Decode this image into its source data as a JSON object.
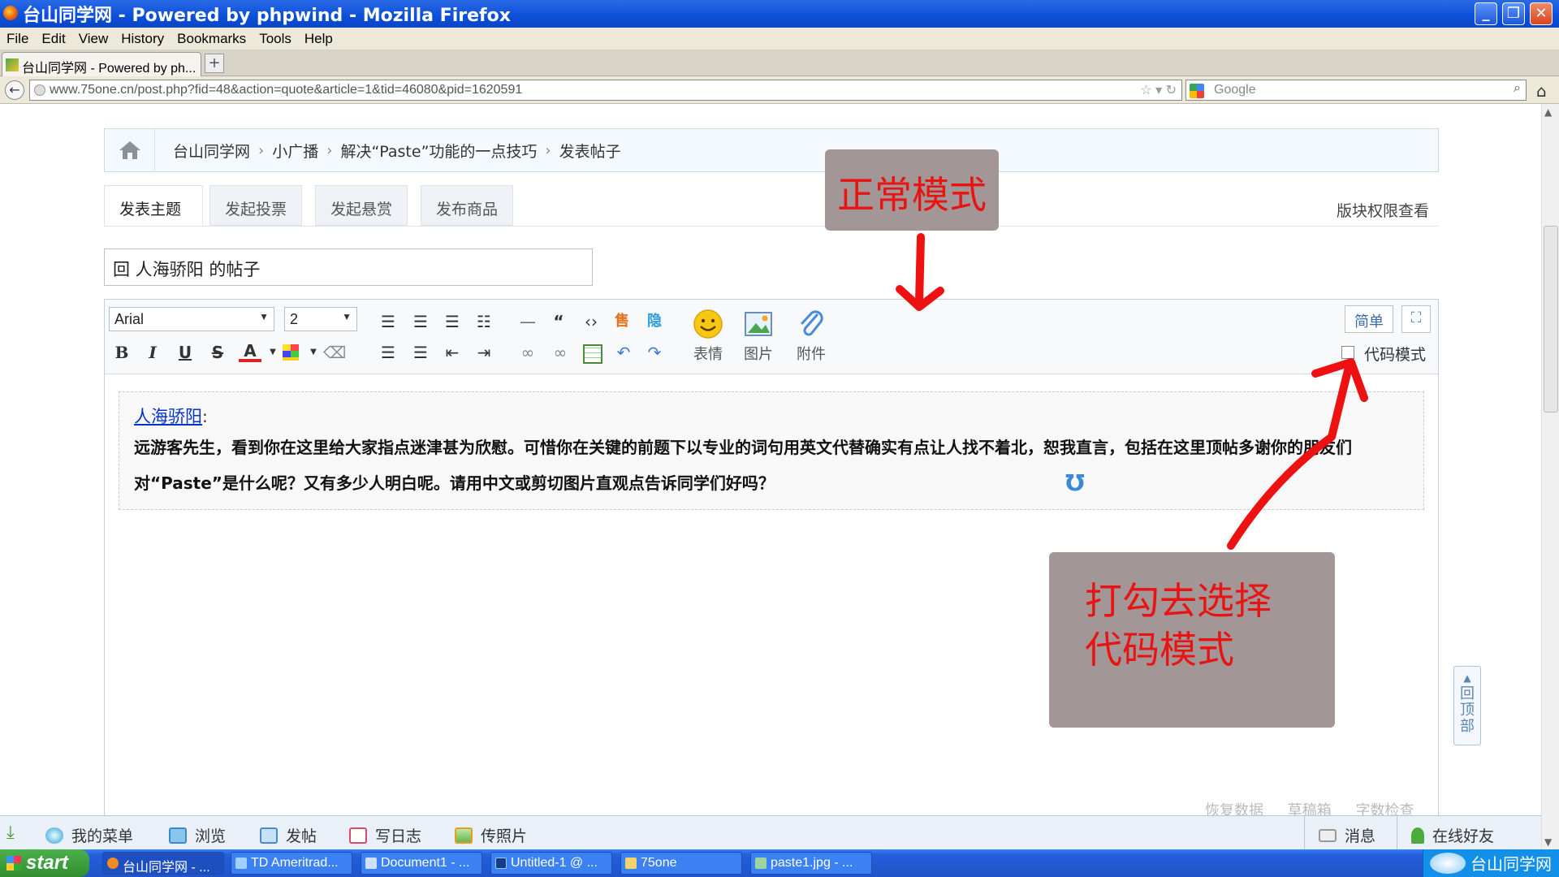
{
  "window": {
    "title": "台山同学网 - Powered by phpwind - Mozilla Firefox"
  },
  "menu": [
    "File",
    "Edit",
    "View",
    "History",
    "Bookmarks",
    "Tools",
    "Help"
  ],
  "browser": {
    "tab_title": "台山同学网 - Powered by ph...",
    "url": "www.75one.cn/post.php?fid=48&action=quote&article=1&tid=46080&pid=1620591",
    "search_placeholder": "Google"
  },
  "breadcrumb": [
    "台山同学网",
    "小广播",
    "解决“Paste”功能的一点技巧",
    "发表帖子"
  ],
  "tabs": [
    "发表主题",
    "发起投票",
    "发起悬赏",
    "发布商品"
  ],
  "permission_link": "版块权限查看",
  "subject": "回 人海骄阳 的帖子",
  "editor": {
    "font": "Arial",
    "size": "2",
    "emoji_label": "表情",
    "image_label": "图片",
    "attach_label": "附件",
    "simple_label": "简单",
    "code_mode_label": "代码模式",
    "quote_author": "人海骄阳",
    "quote_colon": ":",
    "quote_text": "远游客先生，看到你在这里给大家指点迷津甚为欣慰。可惜你在关键的前题下以专业的词句用英文代替确实有点让人找不着北，恕我直言，包括在这里顶帖多谢你的朋友们对“Paste”是什么呢？又有多少人明白呢。请用中文或剪切图片直观点告诉同学们好吗？",
    "footer_links": [
      "恢复数据",
      "草稿箱",
      "字数检查"
    ]
  },
  "annotations": {
    "normal_mode": "正常模式",
    "tick_line1": "打勾去选择",
    "tick_line2": "代码模式"
  },
  "back_to_top": [
    "回",
    "顶",
    "部"
  ],
  "site_toolbar": {
    "items": [
      "我的菜单",
      "浏览",
      "发帖",
      "写日志",
      "传照片"
    ],
    "messages": "消息",
    "online_friends": "在线好友"
  },
  "taskbar": {
    "start": "start",
    "tasks": [
      "台山同学网 - ...",
      "TD Ameritrad...",
      "Document1 - ...",
      "Untitled-1 @ ...",
      "75one",
      "paste1.jpg - ..."
    ],
    "tray_text": "台山同学网"
  }
}
